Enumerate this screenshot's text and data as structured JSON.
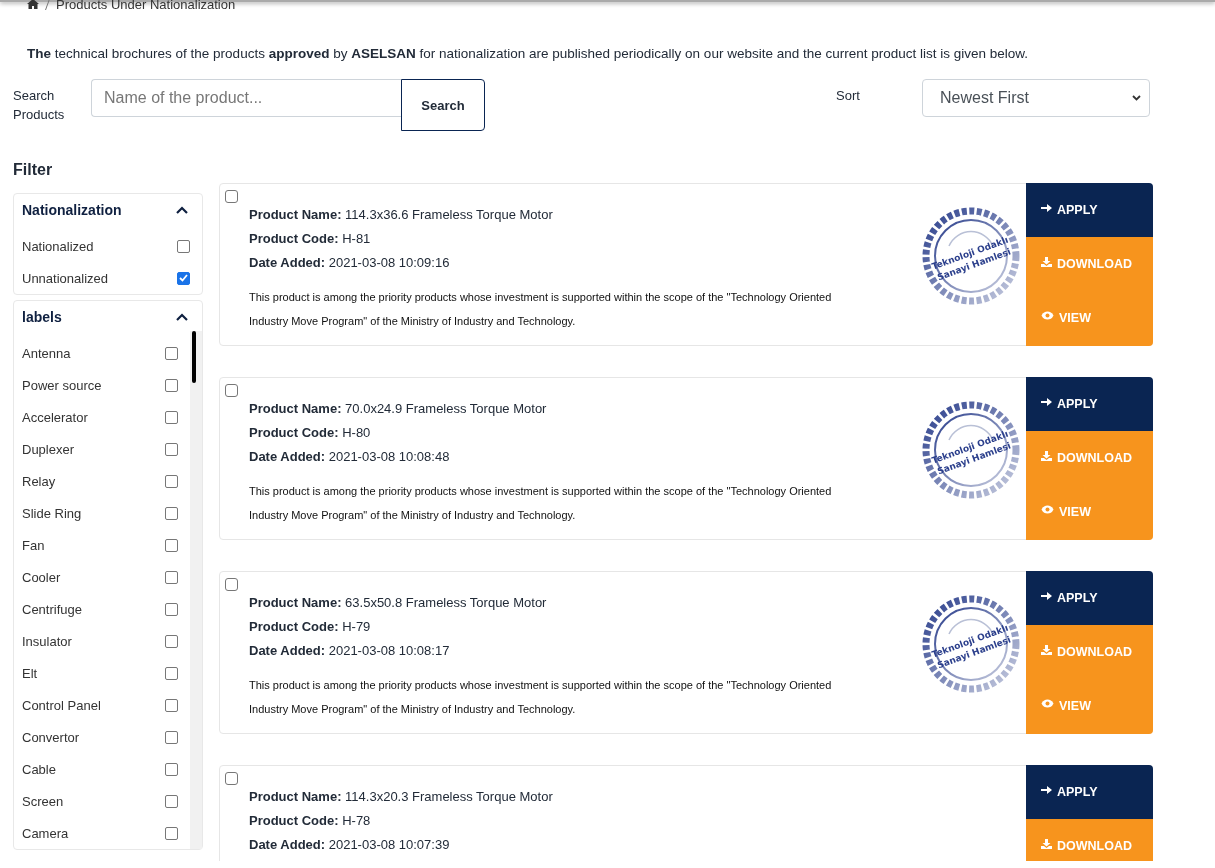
{
  "breadcrumb": {
    "items": [
      "Products Under Nationalization"
    ]
  },
  "intro": "**The** technical brochures of the products **approved** by **ASELSAN** for nationalization are published periodically on our website and the current product list is given below.",
  "search": {
    "label": "Search Products",
    "placeholder": "Name of the product...",
    "button": "Search"
  },
  "sort": {
    "label": "Sort",
    "value": "Newest First"
  },
  "filter": {
    "title": "Filter",
    "groups": [
      {
        "title": "Nationalization",
        "expanded": true,
        "scrollable": false,
        "options": [
          {
            "label": "Nationalized",
            "checked": false
          },
          {
            "label": "Unnationalized",
            "checked": true
          }
        ]
      },
      {
        "title": "labels",
        "expanded": true,
        "scrollable": true,
        "options": [
          {
            "label": "Antenna",
            "checked": false
          },
          {
            "label": "Power source",
            "checked": false
          },
          {
            "label": "Accelerator",
            "checked": false
          },
          {
            "label": "Duplexer",
            "checked": false
          },
          {
            "label": "Relay",
            "checked": false
          },
          {
            "label": "Slide Ring",
            "checked": false
          },
          {
            "label": "Fan",
            "checked": false
          },
          {
            "label": "Cooler",
            "checked": false
          },
          {
            "label": "Centrifuge",
            "checked": false
          },
          {
            "label": "Insulator",
            "checked": false
          },
          {
            "label": "Elt",
            "checked": false
          },
          {
            "label": "Control Panel",
            "checked": false
          },
          {
            "label": "Convertor",
            "checked": false
          },
          {
            "label": "Cable",
            "checked": false
          },
          {
            "label": "Screen",
            "checked": false
          },
          {
            "label": "Camera",
            "checked": false
          }
        ]
      }
    ]
  },
  "products": [
    {
      "selected": false,
      "fields": [
        "**Product Name:** 114.3x36.6 Frameless Torque Motor",
        "**Product Code:** H-81",
        "**Date Added:** 2021-03-08 10:09:16"
      ],
      "note": "This product is among the priority products whose investment is supported within the scope of the \"Technology Oriented Industry Move Program\" of the Ministry of Industry and Technology.",
      "badge": [
        "Teknoloji Odaklı",
        "Sanayi Hamlesi"
      ],
      "actions": [
        {
          "kind": "apply",
          "label": "APPLY"
        },
        {
          "kind": "download",
          "label": "DOWNLOAD"
        },
        {
          "kind": "view",
          "label": "VIEW"
        }
      ]
    },
    {
      "selected": false,
      "fields": [
        "**Product Name:** 70.0x24.9 Frameless Torque Motor",
        "**Product Code:** H-80",
        "**Date Added:** 2021-03-08 10:08:48"
      ],
      "note": "This product is among the priority products whose investment is supported within the scope of the \"Technology Oriented Industry Move Program\" of the Ministry of Industry and Technology.",
      "badge": [
        "Teknoloji Odaklı",
        "Sanayi Hamlesi"
      ],
      "actions": [
        {
          "kind": "apply",
          "label": "APPLY"
        },
        {
          "kind": "download",
          "label": "DOWNLOAD"
        },
        {
          "kind": "view",
          "label": "VIEW"
        }
      ]
    },
    {
      "selected": false,
      "fields": [
        "**Product Name:** 63.5x50.8 Frameless Torque Motor",
        "**Product Code:** H-79",
        "**Date Added:** 2021-03-08 10:08:17"
      ],
      "note": "This product is among the priority products whose investment is supported within the scope of the \"Technology Oriented Industry Move Program\" of the Ministry of Industry and Technology.",
      "badge": [
        "Teknoloji Odaklı",
        "Sanayi Hamlesi"
      ],
      "actions": [
        {
          "kind": "apply",
          "label": "APPLY"
        },
        {
          "kind": "download",
          "label": "DOWNLOAD"
        },
        {
          "kind": "view",
          "label": "VIEW"
        }
      ]
    },
    {
      "selected": false,
      "fields": [
        "**Product Name:** 114.3x20.3 Frameless Torque Motor",
        "**Product Code:** H-78",
        "**Date Added:** 2021-03-08 10:07:39"
      ],
      "actions": [
        {
          "kind": "apply",
          "label": "APPLY"
        },
        {
          "kind": "download",
          "label": "DOWNLOAD"
        }
      ]
    }
  ]
}
